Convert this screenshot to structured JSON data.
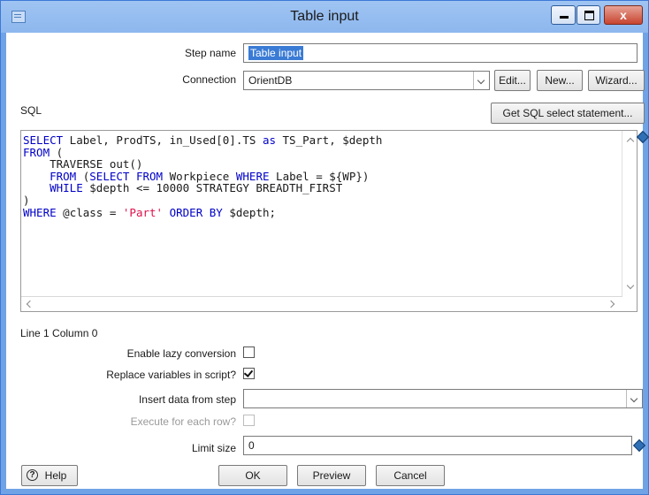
{
  "window": {
    "title": "Table input"
  },
  "window_buttons": {
    "minimize": "–",
    "maximize": "□",
    "close": "x"
  },
  "form": {
    "step_name_label": "Step name",
    "step_name_value": "Table input",
    "connection_label": "Connection",
    "connection_value": "OrientDB",
    "edit_button": "Edit...",
    "new_button": "New...",
    "wizard_button": "Wizard...",
    "sql_label": "SQL",
    "get_sql_button": "Get SQL select statement...",
    "sql_lines": [
      [
        {
          "t": "SELECT",
          "c": "kw"
        },
        {
          "t": " Label, ProdTS, in_Used[0].TS ",
          "c": ""
        },
        {
          "t": "as",
          "c": "kw"
        },
        {
          "t": " TS_Part, $depth",
          "c": ""
        }
      ],
      [
        {
          "t": "FROM",
          "c": "kw"
        },
        {
          "t": " (",
          "c": ""
        }
      ],
      [
        {
          "t": "    TRAVERSE out()",
          "c": ""
        }
      ],
      [
        {
          "t": "    ",
          "c": ""
        },
        {
          "t": "FROM",
          "c": "kw"
        },
        {
          "t": " (",
          "c": ""
        },
        {
          "t": "SELECT FROM",
          "c": "kw"
        },
        {
          "t": " Workpiece ",
          "c": ""
        },
        {
          "t": "WHERE",
          "c": "kw"
        },
        {
          "t": " Label = ${WP})",
          "c": ""
        }
      ],
      [
        {
          "t": "    ",
          "c": ""
        },
        {
          "t": "WHILE",
          "c": "kw"
        },
        {
          "t": " $depth <= 10000 STRATEGY BREADTH_FIRST",
          "c": ""
        }
      ],
      [
        {
          "t": ")",
          "c": ""
        }
      ],
      [
        {
          "t": "WHERE",
          "c": "kw"
        },
        {
          "t": " @class = ",
          "c": ""
        },
        {
          "t": "'Part'",
          "c": "str"
        },
        {
          "t": " ",
          "c": ""
        },
        {
          "t": "ORDER BY",
          "c": "kw"
        },
        {
          "t": " $depth;",
          "c": ""
        }
      ]
    ],
    "cursor_position": "Line 1 Column 0",
    "lazy_label": "Enable lazy conversion",
    "lazy_checked": false,
    "replace_label": "Replace variables in script?",
    "replace_checked": true,
    "insert_label": "Insert data from step",
    "insert_value": "",
    "execute_label": "Execute for each row?",
    "execute_checked": false,
    "limit_label": "Limit size",
    "limit_value": "0"
  },
  "footer": {
    "help_label": "Help",
    "ok_label": "OK",
    "preview_label": "Preview",
    "cancel_label": "Cancel"
  }
}
